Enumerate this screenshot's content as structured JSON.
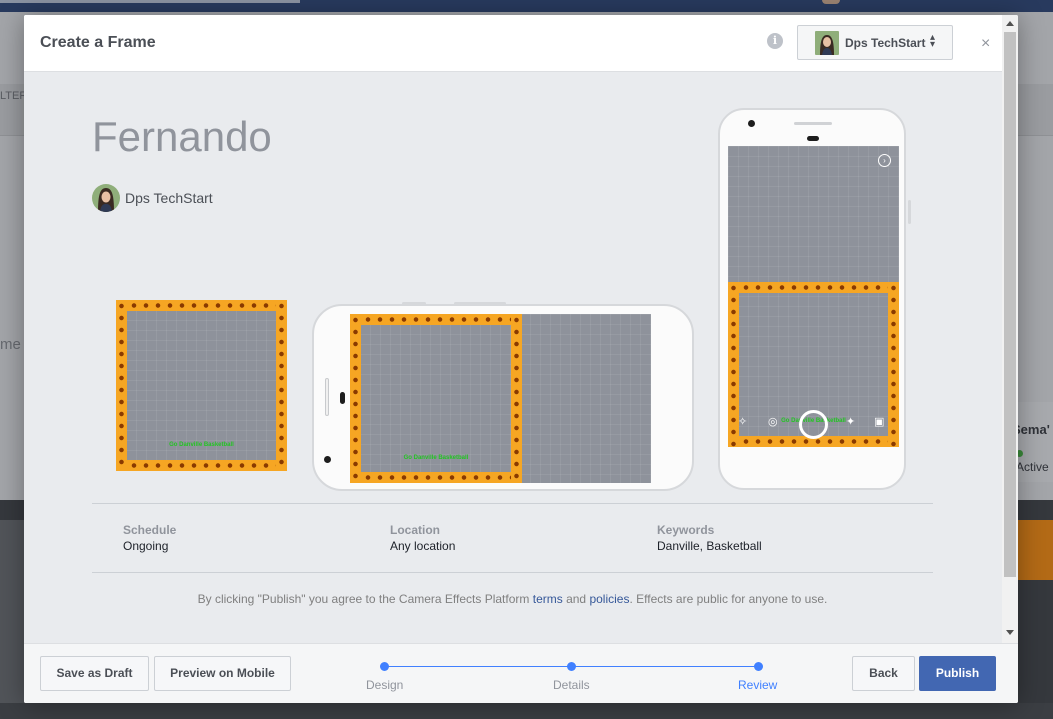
{
  "background": {
    "left_nav_text": "LTER",
    "left_big_text": "me",
    "right_card_name": "Sema'",
    "right_card_status": "Active"
  },
  "modal": {
    "title": "Create a Frame",
    "account_name": "Dps TechStart",
    "close_symbol": "×",
    "info_symbol": "i"
  },
  "frame": {
    "name": "Fernando",
    "owner": "Dps TechStart",
    "tagline": "Go Danville Basketball"
  },
  "details": [
    {
      "label": "Schedule",
      "value": "Ongoing"
    },
    {
      "label": "Location",
      "value": "Any location"
    },
    {
      "label": "Keywords",
      "value": "Danville, Basketball"
    }
  ],
  "disclaimer": {
    "before": "By clicking \"Publish\" you agree to the Camera Effects Platform ",
    "terms": "terms",
    "and": " and ",
    "policies": "policies",
    "after": ". Effects are public for anyone to use."
  },
  "footer": {
    "save_draft": "Save as Draft",
    "preview_mobile": "Preview on Mobile",
    "steps": [
      "Design",
      "Details",
      "Review"
    ],
    "active_step": "Review",
    "back": "Back",
    "publish": "Publish"
  },
  "colors": {
    "primary": "#4267b2",
    "step_blue": "#4080ff",
    "frame_orange": "#f6a623",
    "tagline_green": "#23c423"
  }
}
